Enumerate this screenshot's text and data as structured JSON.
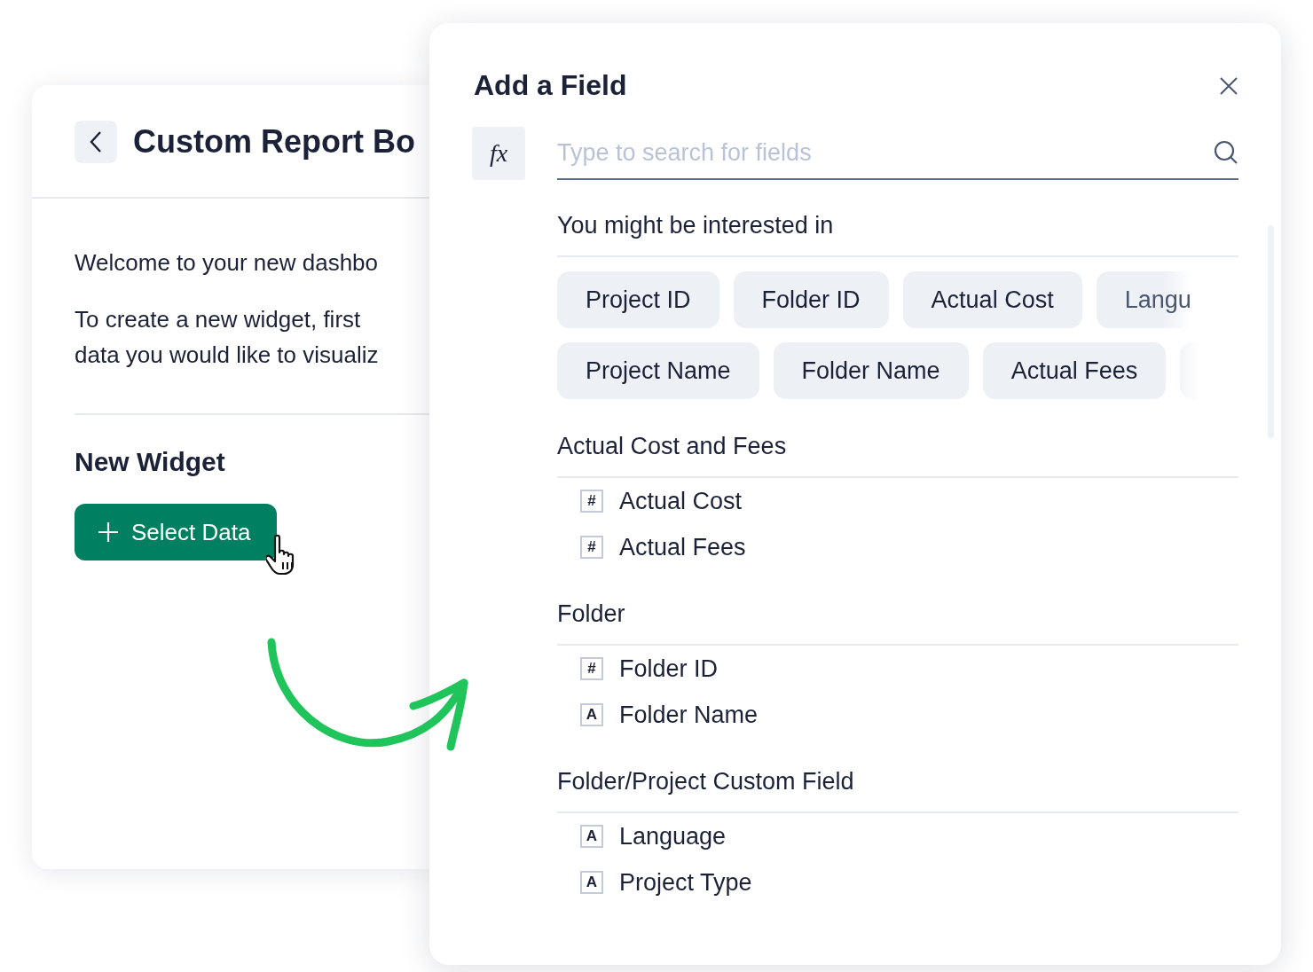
{
  "dashboard": {
    "title": "Custom Report Bo",
    "intro": "Welcome to your new dashbo",
    "instructions": [
      "To create a new widget, first",
      "data you would like to visualiz"
    ],
    "widget_heading": "New Widget",
    "select_button": "Select Data"
  },
  "field_panel": {
    "title": "Add a Field",
    "formula_button": "fx",
    "search": {
      "placeholder": "Type to search for fields"
    },
    "suggestions": {
      "heading": "You might be interested in",
      "chips": [
        [
          "Project ID",
          "Folder ID",
          "Actual Cost",
          "Langu"
        ],
        [
          "Project Name",
          "Folder Name",
          "Actual Fees"
        ]
      ]
    },
    "groups": [
      {
        "heading": "Actual Cost and Fees",
        "fields": [
          {
            "type_icon": "#",
            "label": "Actual Cost"
          },
          {
            "type_icon": "#",
            "label": "Actual Fees"
          }
        ]
      },
      {
        "heading": "Folder",
        "fields": [
          {
            "type_icon": "#",
            "label": "Folder ID"
          },
          {
            "type_icon": "A",
            "label": "Folder Name"
          }
        ]
      },
      {
        "heading": "Folder/Project Custom Field",
        "fields": [
          {
            "type_icon": "A",
            "label": "Language"
          },
          {
            "type_icon": "A",
            "label": "Project Type"
          }
        ]
      }
    ]
  }
}
